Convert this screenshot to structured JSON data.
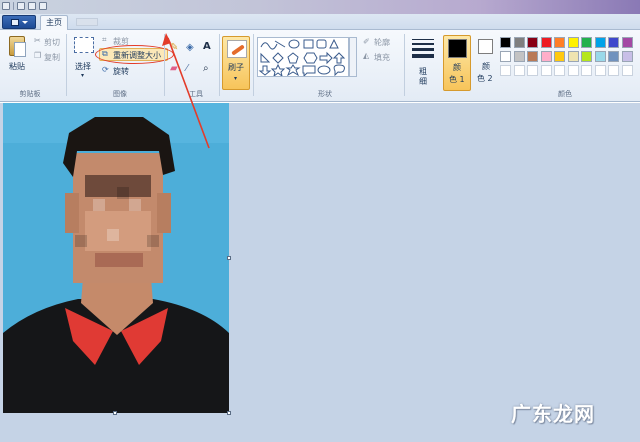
{
  "tabs": {
    "home": "主页"
  },
  "clipboard": {
    "paste": "粘贴",
    "cut": "剪切",
    "copy": "复制",
    "group": "剪贴板"
  },
  "image": {
    "select": "选择",
    "crop": "裁剪",
    "resize": "重新调整大小",
    "rotate": "旋转",
    "group": "图像"
  },
  "tools": {
    "group": "工具"
  },
  "brushes": {
    "label": "刷子"
  },
  "shapes": {
    "outline": "轮廓",
    "fill": "填充",
    "group": "形状"
  },
  "size": {
    "label1": "粗",
    "label2": "细"
  },
  "color1": {
    "label1": "颜",
    "label2": "色 1",
    "value": "#000000"
  },
  "color2": {
    "label1": "颜",
    "label2": "色 2",
    "value": "#ffffff"
  },
  "colors_group": "颜色",
  "palette_row1": [
    "#000000",
    "#7f7f7f",
    "#880015",
    "#ed1c24",
    "#ff7f27",
    "#fff200",
    "#22b14c",
    "#00a2e8",
    "#3f48cc",
    "#a349a4"
  ],
  "palette_row2": [
    "#ffffff",
    "#c3c3c3",
    "#b97a57",
    "#ffaec9",
    "#ffc90e",
    "#efe4b0",
    "#b5e61d",
    "#99d9ea",
    "#7092be",
    "#c8bfe7"
  ],
  "watermark": "广东龙网",
  "accent": {
    "highlight": "#e33c2a",
    "ribbon_active": "#f7c45a"
  }
}
